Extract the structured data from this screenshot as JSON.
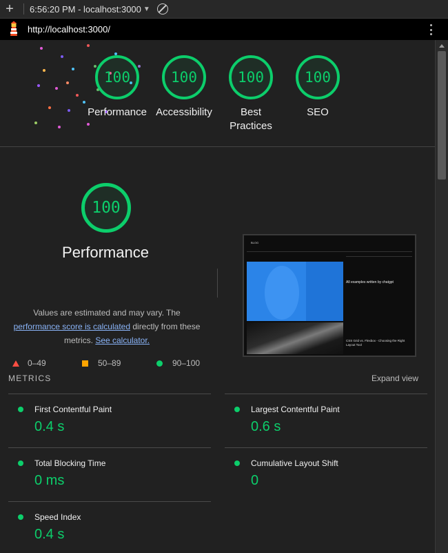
{
  "browser": {
    "time_host": "6:56:20 PM - localhost:3000",
    "url": "http://localhost:3000/"
  },
  "colors": {
    "pass": "#0cce6b",
    "average": "#ffa400",
    "fail": "#ff4e42",
    "link": "#8ab4f8"
  },
  "gauges": [
    {
      "score": "100",
      "label": "Performance"
    },
    {
      "score": "100",
      "label": "Accessibility"
    },
    {
      "score": "100",
      "label": "Best",
      "label2": "Practices"
    },
    {
      "score": "100",
      "label": "SEO"
    }
  ],
  "performance": {
    "score": "100",
    "title": "Performance",
    "desc_line1": "Values are estimated and may vary. The",
    "desc_link1": "performance score is calculated",
    "desc_line2_rest": " directly from these",
    "desc_line3_start": "metrics. ",
    "desc_link2": "See calculator.",
    "legend": {
      "fail": "0–49",
      "average": "50–89",
      "pass": "90–100"
    }
  },
  "screenshot": {
    "nav_text": "BLOG",
    "side_title": "All examples written by chatgpt",
    "bottom_title": "CSS Grid vs. Flexbox - Choosing the Right Layout Tool"
  },
  "metrics": {
    "header": "METRICS",
    "expand_label": "Expand view",
    "items": [
      {
        "name": "First Contentful Paint",
        "value": "0.4 s"
      },
      {
        "name": "Largest Contentful Paint",
        "value": "0.6 s"
      },
      {
        "name": "Total Blocking Time",
        "value": "0 ms"
      },
      {
        "name": "Cumulative Layout Shift",
        "value": "0"
      },
      {
        "name": "Speed Index",
        "value": "0.4 s"
      }
    ]
  }
}
